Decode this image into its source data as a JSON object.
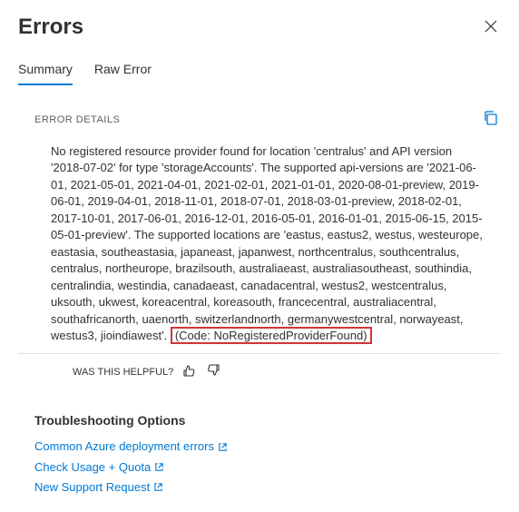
{
  "header": {
    "title": "Errors"
  },
  "tabs": {
    "summary": "Summary",
    "raw": "Raw Error"
  },
  "details": {
    "section_label": "ERROR DETAILS",
    "message": "No registered resource provider found for location 'centralus' and API version '2018-07-02' for type 'storageAccounts'. The supported api-versions are '2021-06-01, 2021-05-01, 2021-04-01, 2021-02-01, 2021-01-01, 2020-08-01-preview, 2019-06-01, 2019-04-01, 2018-11-01, 2018-07-01, 2018-03-01-preview, 2018-02-01, 2017-10-01, 2017-06-01, 2016-12-01, 2016-05-01, 2016-01-01, 2015-06-15, 2015-05-01-preview'. The supported locations are 'eastus, eastus2, westus, westeurope, eastasia, southeastasia, japaneast, japanwest, northcentralus, southcentralus, centralus, northeurope, brazilsouth, australiaeast, australiasoutheast, southindia, centralindia, westindia, canadaeast, canadacentral, westus2, westcentralus, uksouth, ukwest, koreacentral, koreasouth, francecentral, australiacentral, southafricanorth, uaenorth, switzerlandnorth, germanywestcentral, norwayeast, westus3, jioindiawest'. ",
    "code_text": "(Code: NoRegisteredProviderFound)"
  },
  "helpful": {
    "label": "WAS THIS HELPFUL?"
  },
  "troubleshooting": {
    "heading": "Troubleshooting Options",
    "links": {
      "common": "Common Azure deployment errors",
      "quota": "Check Usage + Quota",
      "support": "New Support Request"
    }
  }
}
